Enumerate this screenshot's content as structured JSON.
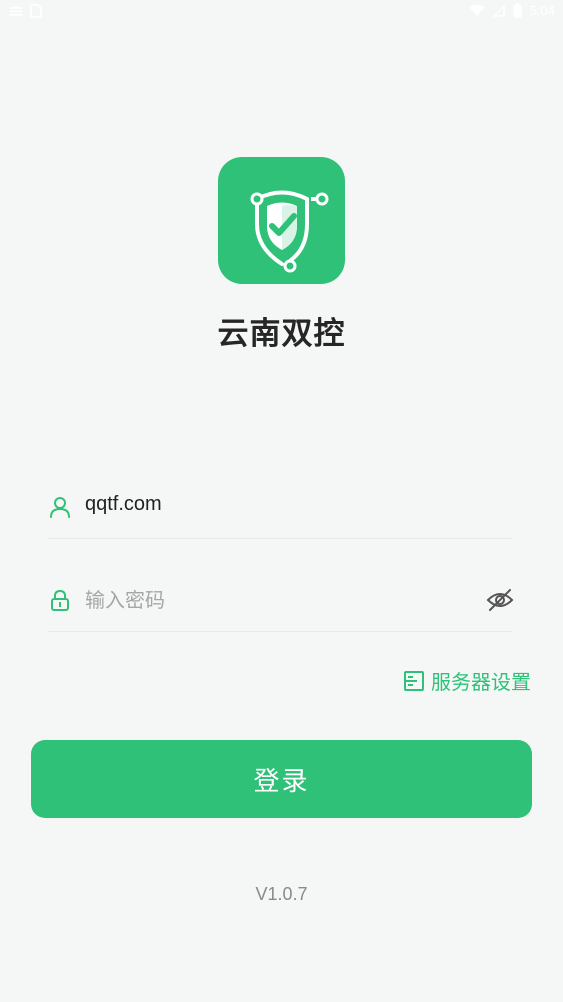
{
  "status_bar": {
    "time": "5:04",
    "icons": [
      "wifi-icon",
      "battery-icon"
    ]
  },
  "app": {
    "name": "云南双控",
    "logo_icon": "shield-check-icon",
    "accent_color": "#2fc178"
  },
  "login_form": {
    "username": {
      "icon": "user-icon",
      "value": "qqtf.com"
    },
    "password": {
      "icon": "lock-icon",
      "placeholder": "输入密码",
      "toggle_icon": "eye-off-icon"
    },
    "server_settings": {
      "icon": "server-icon",
      "label": "服务器设置"
    },
    "login_button": {
      "label": "登录"
    }
  },
  "footer": {
    "version": "V1.0.7"
  }
}
